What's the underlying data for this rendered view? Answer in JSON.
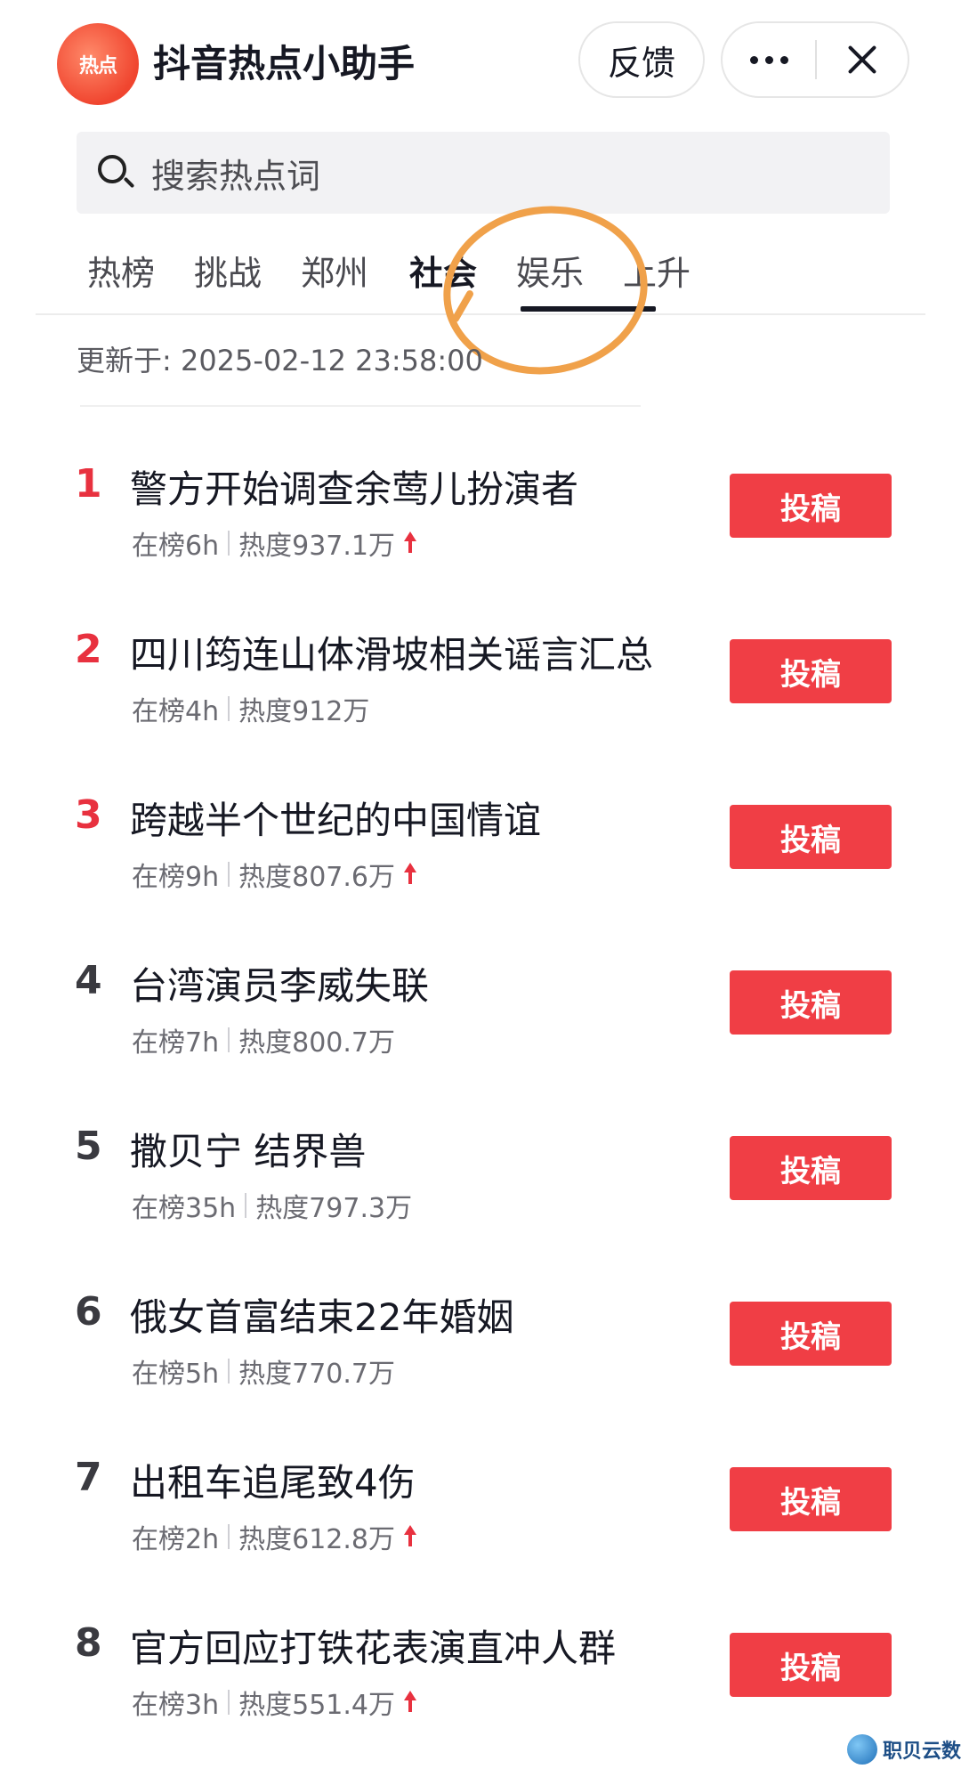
{
  "header": {
    "logo_text": "热点",
    "title": "抖音热点小助手",
    "feedback_label": "反馈"
  },
  "search": {
    "placeholder": "搜索热点词"
  },
  "tabs": [
    {
      "label": "热榜",
      "active": false
    },
    {
      "label": "挑战",
      "active": false
    },
    {
      "label": "郑州",
      "active": false
    },
    {
      "label": "社会",
      "active": true
    },
    {
      "label": "娱乐",
      "active": false
    },
    {
      "label": "上升",
      "active": false
    }
  ],
  "update_time": "更新于: 2025-02-12 23:58:00",
  "items": [
    {
      "rank": "1",
      "title": "警方开始调查余莺儿扮演者",
      "on_list": "在榜6h",
      "heat": "热度937.1万",
      "rising": true,
      "button": "投稿"
    },
    {
      "rank": "2",
      "title": "四川筠连山体滑坡相关谣言汇总",
      "on_list": "在榜4h",
      "heat": "热度912万",
      "rising": false,
      "button": "投稿"
    },
    {
      "rank": "3",
      "title": "跨越半个世纪的中国情谊",
      "on_list": "在榜9h",
      "heat": "热度807.6万",
      "rising": true,
      "button": "投稿"
    },
    {
      "rank": "4",
      "title": "台湾演员李威失联",
      "on_list": "在榜7h",
      "heat": "热度800.7万",
      "rising": false,
      "button": "投稿"
    },
    {
      "rank": "5",
      "title": "撒贝宁 结界兽",
      "on_list": "在榜35h",
      "heat": "热度797.3万",
      "rising": false,
      "button": "投稿"
    },
    {
      "rank": "6",
      "title": "俄女首富结束22年婚姻",
      "on_list": "在榜5h",
      "heat": "热度770.7万",
      "rising": false,
      "button": "投稿"
    },
    {
      "rank": "7",
      "title": "出租车追尾致4伤",
      "on_list": "在榜2h",
      "heat": "热度612.8万",
      "rising": true,
      "button": "投稿"
    },
    {
      "rank": "8",
      "title": "官方回应打铁花表演直冲人群",
      "on_list": "在榜3h",
      "heat": "热度551.4万",
      "rising": true,
      "button": "投稿"
    }
  ],
  "watermark": "职贝云数",
  "colors": {
    "accent": "#f03e45",
    "rank_highlight": "#e8313f",
    "annotation": "#f0a14a"
  }
}
